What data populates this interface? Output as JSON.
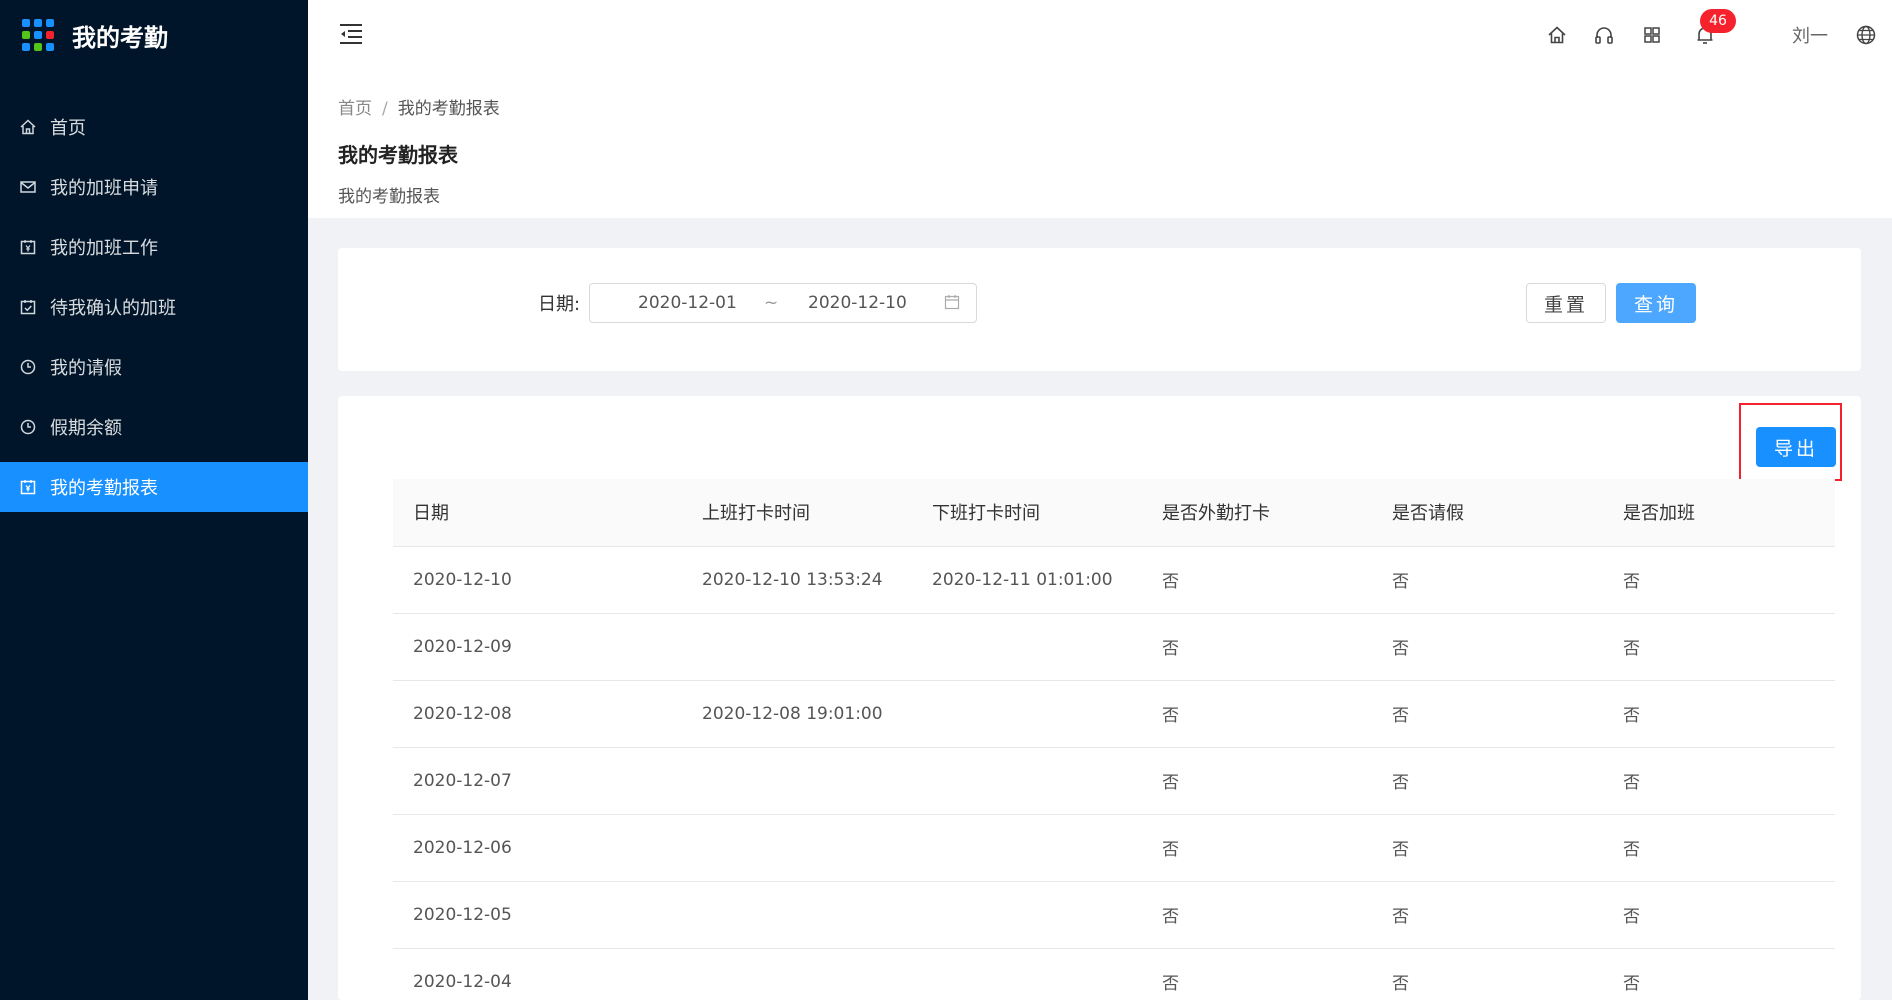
{
  "app": {
    "title": "我的考勤"
  },
  "sidebar": {
    "items": [
      {
        "label": "首页",
        "icon": "home-icon"
      },
      {
        "label": "我的加班申请",
        "icon": "mail-icon"
      },
      {
        "label": "我的加班工作",
        "icon": "calendar-yen-icon"
      },
      {
        "label": "待我确认的加班",
        "icon": "calendar-check-icon"
      },
      {
        "label": "我的请假",
        "icon": "clock-icon"
      },
      {
        "label": "假期余额",
        "icon": "clock-icon"
      },
      {
        "label": "我的考勤报表",
        "icon": "calendar-yen-icon",
        "active": true
      }
    ]
  },
  "header": {
    "notification_count": "46",
    "user_name": "刘一",
    "icons": [
      "home-icon",
      "headset-icon",
      "apps-icon",
      "bell-icon",
      "globe-icon"
    ]
  },
  "page": {
    "breadcrumb": {
      "home": "首页",
      "separator": "/",
      "current": "我的考勤报表"
    },
    "title": "我的考勤报表",
    "description": "我的考勤报表"
  },
  "filter": {
    "date_label": "日期:",
    "start_date": "2020-12-01",
    "separator": "~",
    "end_date": "2020-12-10",
    "reset_label": "重置",
    "query_label": "查询"
  },
  "table": {
    "export_label": "导出",
    "columns": [
      "日期",
      "上班打卡时间",
      "下班打卡时间",
      "是否外勤打卡",
      "是否请假",
      "是否加班"
    ],
    "rows": [
      [
        "2020-12-10",
        "2020-12-10 13:53:24",
        "2020-12-11 01:01:00",
        "否",
        "否",
        "否"
      ],
      [
        "2020-12-09",
        "",
        "",
        "否",
        "否",
        "否"
      ],
      [
        "2020-12-08",
        "2020-12-08 19:01:00",
        "",
        "否",
        "否",
        "否"
      ],
      [
        "2020-12-07",
        "",
        "",
        "否",
        "否",
        "否"
      ],
      [
        "2020-12-06",
        "",
        "",
        "否",
        "否",
        "否"
      ],
      [
        "2020-12-05",
        "",
        "",
        "否",
        "否",
        "否"
      ],
      [
        "2020-12-04",
        "",
        "",
        "否",
        "否",
        "否"
      ]
    ]
  },
  "colors": {
    "sidebar_bg": "#001529",
    "primary": "#1890ff",
    "highlight_border": "#f5222d"
  }
}
